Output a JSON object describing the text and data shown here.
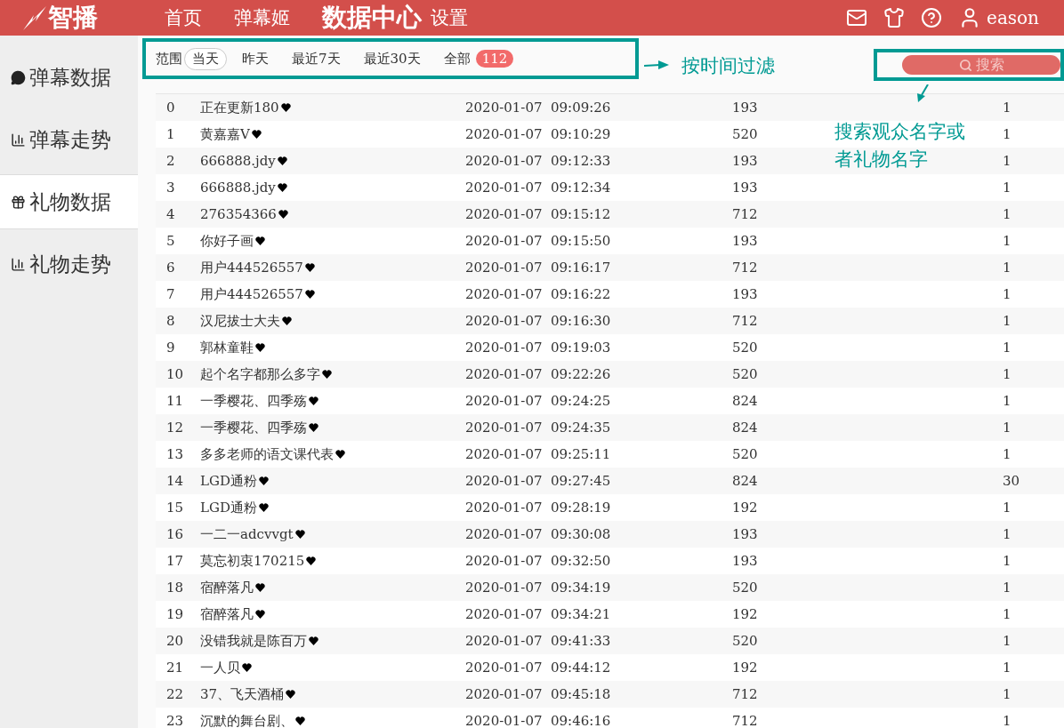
{
  "header": {
    "logo": "智播",
    "nav": [
      {
        "label": "首页",
        "selected": false
      },
      {
        "label": "弹幕姬",
        "selected": false
      },
      {
        "label": "数据中心",
        "selected": true
      },
      {
        "label": "设置",
        "selected": false
      }
    ],
    "user": "eason"
  },
  "sidebar": {
    "items": [
      {
        "kind": "chat",
        "label": "弹幕数据",
        "selected": false
      },
      {
        "kind": "chart",
        "label": "弹幕走势",
        "selected": false
      },
      {
        "kind": "gift",
        "label": "礼物数据",
        "selected": true
      },
      {
        "kind": "chart",
        "label": "礼物走势",
        "selected": false
      }
    ]
  },
  "filter": {
    "label": "范围",
    "options": [
      {
        "label": "当天",
        "selected": true
      },
      {
        "label": "昨天",
        "selected": false
      },
      {
        "label": "最近7天",
        "selected": false
      },
      {
        "label": "最近30天",
        "selected": false
      },
      {
        "label": "全部",
        "selected": false,
        "badge": "112"
      }
    ]
  },
  "search": {
    "placeholder": "搜索"
  },
  "annotations": [
    {
      "kind": "filter",
      "text": "按时间过滤"
    },
    {
      "kind": "search",
      "lines": [
        "搜索观众名字或",
        "者礼物名字"
      ]
    }
  ],
  "table": {
    "rows": [
      {
        "index": "0",
        "name": "正在更新180",
        "time": "2020-01-07  09:09:26",
        "gift": "193",
        "count": "1"
      },
      {
        "index": "1",
        "name": "黄嘉嘉V",
        "time": "2020-01-07  09:10:29",
        "gift": "520",
        "count": "1"
      },
      {
        "index": "2",
        "name": "666888.jdy",
        "time": "2020-01-07  09:12:33",
        "gift": "193",
        "count": "1"
      },
      {
        "index": "3",
        "name": "666888.jdy",
        "time": "2020-01-07  09:12:34",
        "gift": "193",
        "count": "1"
      },
      {
        "index": "4",
        "name": "276354366",
        "time": "2020-01-07  09:15:12",
        "gift": "712",
        "count": "1"
      },
      {
        "index": "5",
        "name": "你好子画",
        "time": "2020-01-07  09:15:50",
        "gift": "193",
        "count": "1"
      },
      {
        "index": "6",
        "name": "用户444526557",
        "time": "2020-01-07  09:16:17",
        "gift": "712",
        "count": "1"
      },
      {
        "index": "7",
        "name": "用户444526557",
        "time": "2020-01-07  09:16:22",
        "gift": "193",
        "count": "1"
      },
      {
        "index": "8",
        "name": "汉尼拔士大夫",
        "time": "2020-01-07  09:16:30",
        "gift": "712",
        "count": "1"
      },
      {
        "index": "9",
        "name": "郭林童鞋",
        "time": "2020-01-07  09:19:03",
        "gift": "520",
        "count": "1"
      },
      {
        "index": "10",
        "name": "起个名字都那么多字",
        "time": "2020-01-07  09:22:26",
        "gift": "520",
        "count": "1"
      },
      {
        "index": "11",
        "name": "一季樱花、四季殇",
        "time": "2020-01-07  09:24:25",
        "gift": "824",
        "count": "1"
      },
      {
        "index": "12",
        "name": "一季樱花、四季殇",
        "time": "2020-01-07  09:24:35",
        "gift": "824",
        "count": "1"
      },
      {
        "index": "13",
        "name": "多多老师的语文课代表",
        "time": "2020-01-07  09:25:11",
        "gift": "520",
        "count": "1"
      },
      {
        "index": "14",
        "name": "LGD通粉",
        "time": "2020-01-07  09:27:45",
        "gift": "824",
        "count": "30"
      },
      {
        "index": "15",
        "name": "LGD通粉",
        "time": "2020-01-07  09:28:19",
        "gift": "192",
        "count": "1"
      },
      {
        "index": "16",
        "name": "一二一adcvvgt",
        "time": "2020-01-07  09:30:08",
        "gift": "193",
        "count": "1"
      },
      {
        "index": "17",
        "name": "莫忘初衷170215",
        "time": "2020-01-07  09:32:50",
        "gift": "193",
        "count": "1"
      },
      {
        "index": "18",
        "name": "宿醉落凡",
        "time": "2020-01-07  09:34:19",
        "gift": "520",
        "count": "1"
      },
      {
        "index": "19",
        "name": "宿醉落凡",
        "time": "2020-01-07  09:34:21",
        "gift": "192",
        "count": "1"
      },
      {
        "index": "20",
        "name": "没错我就是陈百万",
        "time": "2020-01-07  09:41:33",
        "gift": "520",
        "count": "1"
      },
      {
        "index": "21",
        "name": "一人贝",
        "time": "2020-01-07  09:44:12",
        "gift": "192",
        "count": "1"
      },
      {
        "index": "22",
        "name": "37、飞天酒桶",
        "time": "2020-01-07  09:45:18",
        "gift": "712",
        "count": "1"
      },
      {
        "index": "23",
        "name": "沉默的舞台剧、",
        "time": "2020-01-07  09:46:16",
        "gift": "712",
        "count": "1"
      }
    ]
  }
}
